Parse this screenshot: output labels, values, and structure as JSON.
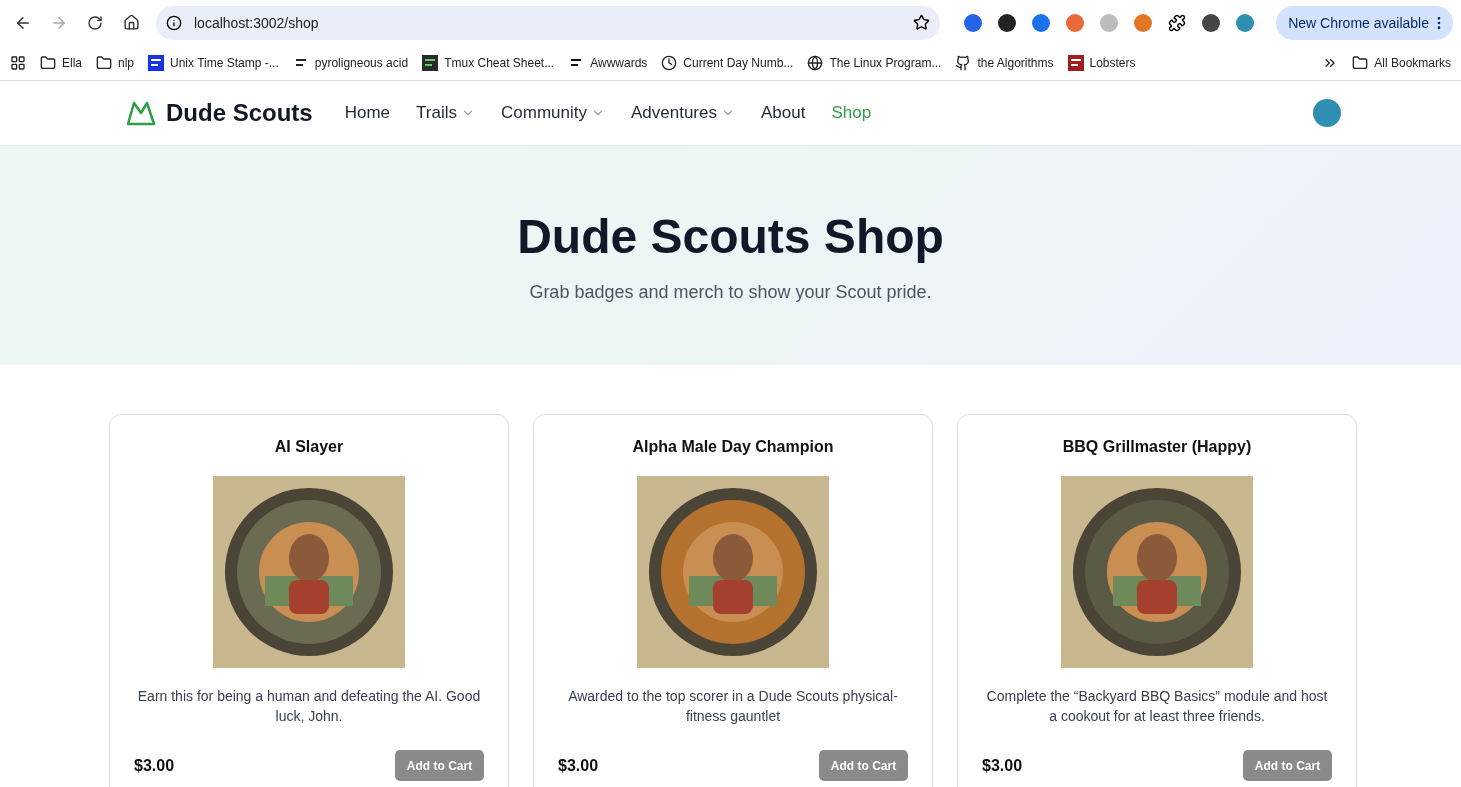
{
  "browser": {
    "url": "localhost:3002/shop",
    "update_button": "New Chrome available",
    "bookmarks": [
      {
        "label": "Ella",
        "kind": "folder"
      },
      {
        "label": "nlp",
        "kind": "folder"
      },
      {
        "label": "Unix Time Stamp -...",
        "kind": "tools"
      },
      {
        "label": "pyroligneous acid",
        "kind": "r6"
      },
      {
        "label": "Tmux Cheat Sheet...",
        "kind": "terminal"
      },
      {
        "label": "Awwwards",
        "kind": "w"
      },
      {
        "label": "Current Day Numb...",
        "kind": "clock"
      },
      {
        "label": "The Linux Program...",
        "kind": "globe"
      },
      {
        "label": "the Algorithms",
        "kind": "github"
      },
      {
        "label": "Lobsters",
        "kind": "lobsters"
      }
    ],
    "all_bookmarks": "All Bookmarks"
  },
  "site": {
    "brand": "Dude Scouts",
    "nav": [
      {
        "label": "Home",
        "dropdown": false,
        "selected": false
      },
      {
        "label": "Trails",
        "dropdown": true,
        "selected": false
      },
      {
        "label": "Community",
        "dropdown": true,
        "selected": false
      },
      {
        "label": "Adventures",
        "dropdown": true,
        "selected": false
      },
      {
        "label": "About",
        "dropdown": false,
        "selected": false
      },
      {
        "label": "Shop",
        "dropdown": false,
        "selected": true
      }
    ]
  },
  "hero": {
    "title": "Dude Scouts Shop",
    "subtitle": "Grab badges and merch to show your Scout pride."
  },
  "products": [
    {
      "name": "AI Slayer",
      "description": "Earn this for being a human and defeating the AI. Good luck, John.",
      "price": "$3.00",
      "button": "Add to Cart",
      "color": "#6b6a52"
    },
    {
      "name": "Alpha Male Day Champion",
      "description": "Awarded to the top scorer in a Dude Scouts physical-fitness gauntlet",
      "price": "$3.00",
      "button": "Add to Cart",
      "color": "#b5722f"
    },
    {
      "name": "BBQ Grillmaster (Happy)",
      "description": "Complete the “Backyard BBQ Basics” module and host a cookout for at least three friends.",
      "price": "$3.00",
      "button": "Add to Cart",
      "color": "#5b5a45"
    }
  ]
}
